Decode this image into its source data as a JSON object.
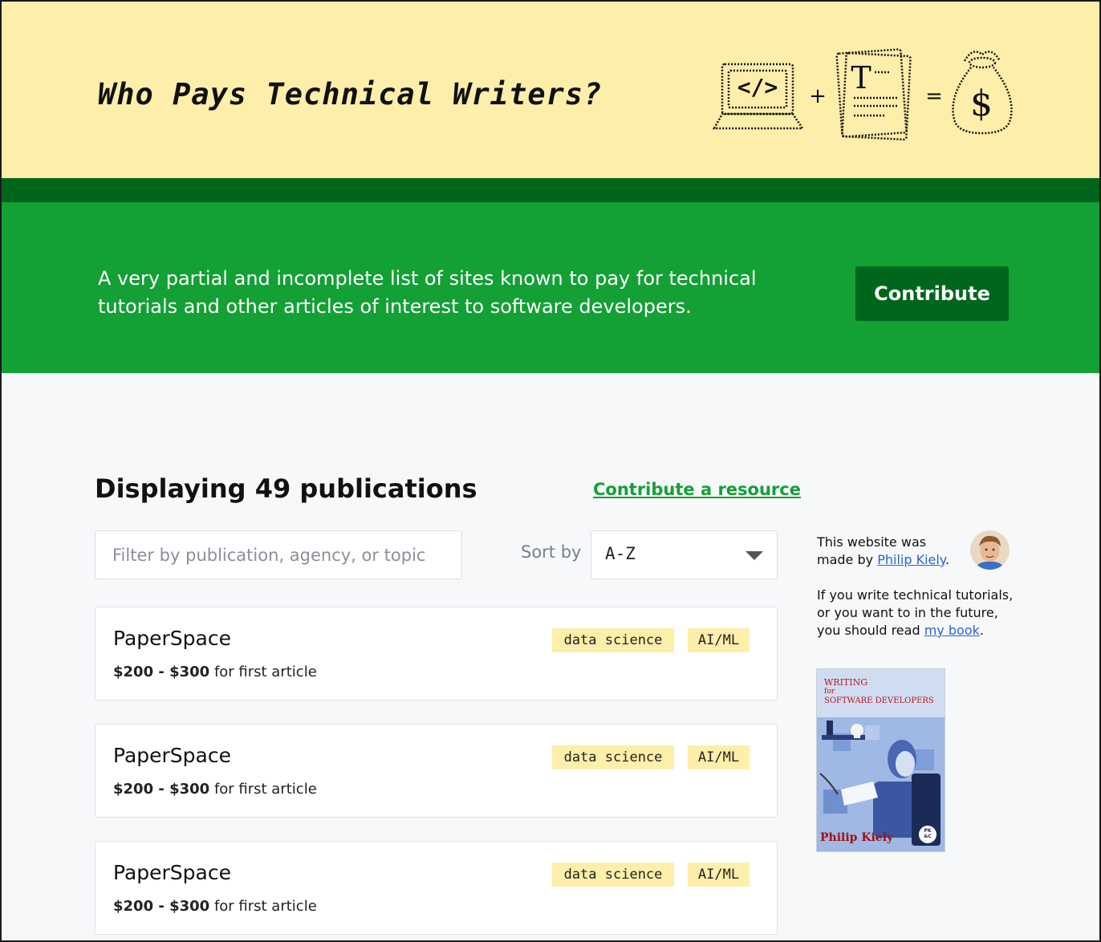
{
  "header": {
    "title": "Who Pays Technical Writers?",
    "equation": {
      "laptop_code": "</>",
      "plus": "+",
      "document_letter": "T",
      "equals": "=",
      "money": "$"
    }
  },
  "hero": {
    "tagline": "A very partial and incomplete list of sites known to pay for technical tutorials and other articles of interest to software developers.",
    "contribute_label": "Contribute"
  },
  "listing": {
    "heading": "Displaying 49 publications",
    "contribute_link": "Contribute a resource",
    "filter_placeholder": "Filter by publication, agency, or topic",
    "sort_label": "Sort by",
    "sort_value": "A-Z"
  },
  "publications": [
    {
      "name": "PaperSpace",
      "pay_range": "$200 - $300",
      "pay_note": "for first article",
      "tags": [
        "data science",
        "AI/ML"
      ]
    },
    {
      "name": "PaperSpace",
      "pay_range": "$200 - $300",
      "pay_note": "for first article",
      "tags": [
        "data science",
        "AI/ML"
      ]
    },
    {
      "name": "PaperSpace",
      "pay_range": "$200 - $300",
      "pay_note": "for first article",
      "tags": [
        "data science",
        "AI/ML"
      ]
    }
  ],
  "sidebar": {
    "made_by_prefix": "This website was made by",
    "author_link": "Philip Kiely",
    "made_by_suffix": ".",
    "book_prefix": "If you write technical tutorials, or you want to in the future, you should read",
    "book_link": "my book",
    "book_suffix": ".",
    "book_cover": {
      "line1": "WRITING",
      "line2": "for",
      "line3": "SOFTWARE DEVELOPERS",
      "author": "Philip Kiely",
      "badge": "PK &C"
    }
  },
  "colors": {
    "banner": "#fdeeaa",
    "dark_green": "#00661c",
    "green": "#13a035",
    "link_blue": "#2b63d9",
    "tag_bg": "#fdeeaa"
  }
}
